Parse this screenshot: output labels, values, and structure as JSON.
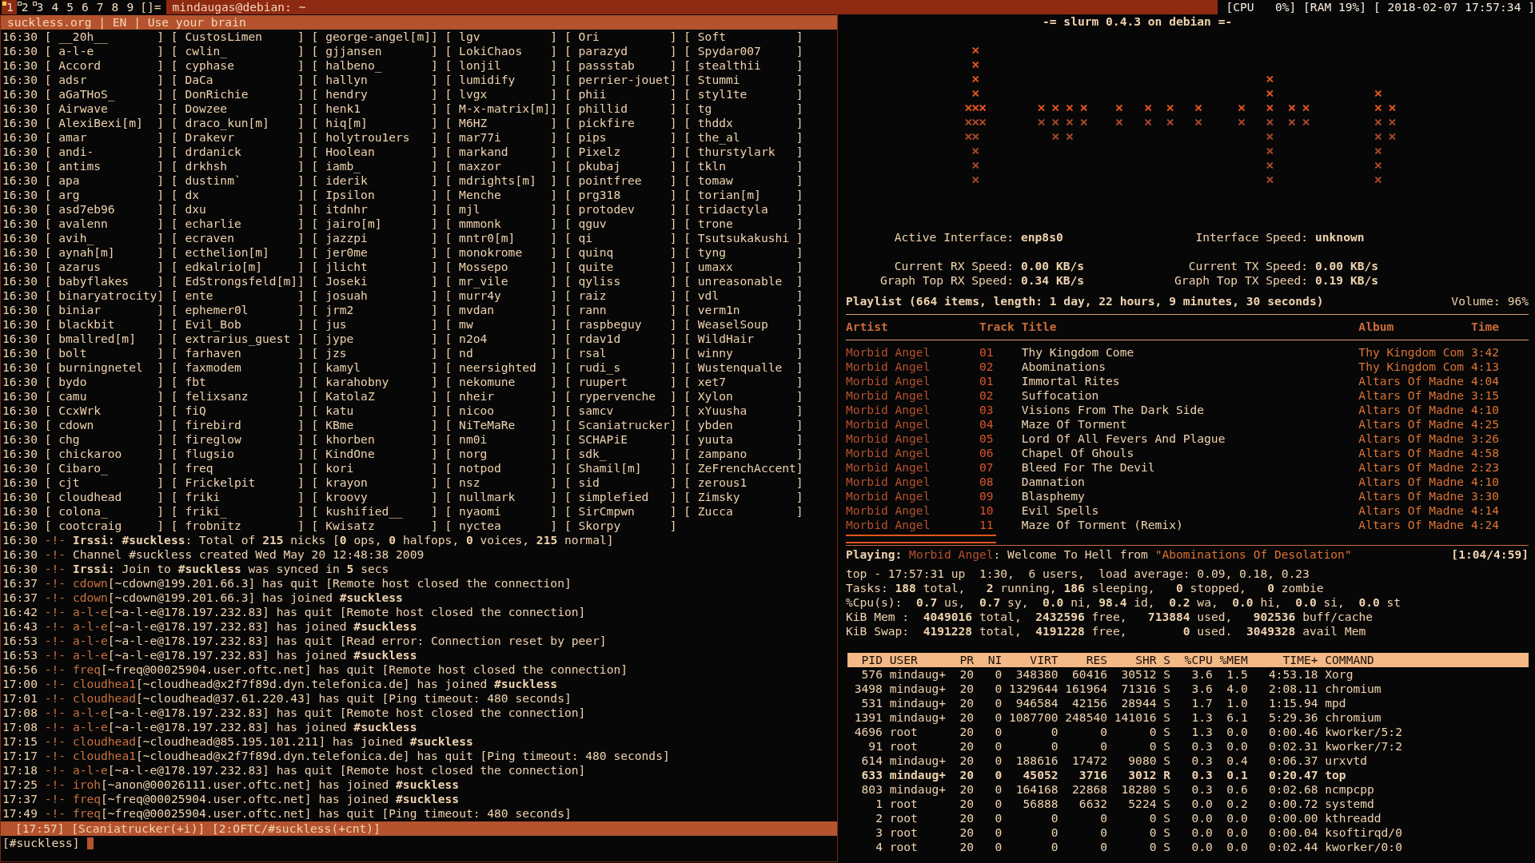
{
  "top_bar": {
    "tags": [
      {
        "label": "1",
        "selected": true,
        "occupied": true
      },
      {
        "label": "2",
        "selected": false,
        "occupied": true
      },
      {
        "label": "3",
        "selected": false,
        "occupied": true
      },
      {
        "label": "4",
        "selected": false,
        "occupied": false
      },
      {
        "label": "5",
        "selected": false,
        "occupied": false
      },
      {
        "label": "6",
        "selected": false,
        "occupied": false
      },
      {
        "label": "7",
        "selected": false,
        "occupied": false
      },
      {
        "label": "8",
        "selected": false,
        "occupied": false
      },
      {
        "label": "9",
        "selected": false,
        "occupied": false
      }
    ],
    "layout": "[]=",
    "title": "mindaugas@debian: ~",
    "status": "[CPU   0%] [RAM 19%] [ 2018-02-07 17:57:34 ]"
  },
  "irc": {
    "topic": "suckless.org | EN | Use your brain",
    "nick_lines": [
      "16:30 [ __20h__       ] [ CustosLimen     ] [ george-angel[m]] [ lgv          ] [ Ori          ] [ Soft          ]",
      "16:30 [ a-l-e         ] [ cwlin_          ] [ gjjansen       ] [ LokiChaos    ] [ parazyd      ] [ Spydar007     ]",
      "16:30 [ Accord        ] [ cyphase         ] [ halbeno_       ] [ lonjil       ] [ passstab     ] [ stealthii     ]",
      "16:30 [ adsr          ] [ DaCa            ] [ hallyn         ] [ lumidify     ] [ perrier-jouet] [ Stummi        ]",
      "16:30 [ aGaTHoS_      ] [ DonRichie       ] [ hendry         ] [ lvgx         ] [ phii         ] [ styl1te       ]",
      "16:30 [ Airwave       ] [ Dowzee          ] [ henk1          ] [ M-x-matrix[m]] [ phillid      ] [ tg            ]",
      "16:30 [ AlexiBexi[m]  ] [ draco_kun[m]    ] [ hiq[m]         ] [ M6HZ         ] [ pickfire     ] [ thddx         ]",
      "16:30 [ amar          ] [ Drakevr         ] [ holytrou1ers   ] [ mar77i       ] [ pips         ] [ the_al        ]",
      "16:30 [ andi-         ] [ drdanick        ] [ Hoolean        ] [ markand      ] [ Pixelz       ] [ thurstylark   ]",
      "16:30 [ antims        ] [ drkhsh          ] [ iamb_          ] [ maxzor       ] [ pkubaj       ] [ tkln          ]",
      "16:30 [ apa           ] [ dustinm`        ] [ iderik         ] [ mdrights[m]  ] [ pointfree    ] [ tomaw         ]",
      "16:30 [ arg           ] [ dx              ] [ Ipsilon        ] [ Menche       ] [ prg318       ] [ torian[m]     ]",
      "16:30 [ asd7eb96      ] [ dxu             ] [ itdnhr         ] [ mjl          ] [ protodev     ] [ tridactyla    ]",
      "16:30 [ avalenn       ] [ echarlie        ] [ jairo[m]       ] [ mmmonk       ] [ qguv         ] [ trone         ]",
      "16:30 [ avih_         ] [ ecraven         ] [ jazzpi         ] [ mntr0[m]     ] [ qi           ] [ Tsutsukakushi ]",
      "16:30 [ aynah[m]      ] [ ecthelion[m]    ] [ jer0me         ] [ monokrome    ] [ quinq        ] [ tyng          ]",
      "16:30 [ azarus        ] [ edkalrio[m]     ] [ jlicht         ] [ Mossepo      ] [ quite        ] [ umaxx         ]",
      "16:30 [ babyflakes    ] [ EdStrongsfeld[m]] [ Joseki         ] [ mr_vile      ] [ qyliss       ] [ unreasonable  ]",
      "16:30 [ binaryatrocity] [ ente            ] [ josuah         ] [ murr4y       ] [ raiz         ] [ vdl           ]",
      "16:30 [ biniar        ] [ ephemer0l       ] [ jrm2           ] [ mvdan        ] [ rann         ] [ verm1n        ]",
      "16:30 [ blackbit      ] [ Evil_Bob        ] [ jus            ] [ mw           ] [ raspbeguy    ] [ WeaselSoup    ]",
      "16:30 [ bmallred[m]   ] [ extrarius_guest ] [ jype           ] [ n2o4         ] [ rdav1d       ] [ WildHair      ]",
      "16:30 [ bolt          ] [ farhaven        ] [ jzs            ] [ nd           ] [ rsal         ] [ winny         ]",
      "16:30 [ burningnetel  ] [ faxmodem        ] [ kamyl          ] [ neersighted  ] [ rudi_s       ] [ Wustenqualle  ]",
      "16:30 [ bydo          ] [ fbt             ] [ karahobny      ] [ nekomune     ] [ ruupert      ] [ xet7          ]",
      "16:30 [ camu          ] [ felixsanz       ] [ KatolaZ        ] [ nheir        ] [ rypervenche  ] [ Xylon         ]",
      "16:30 [ CcxWrk        ] [ fiQ             ] [ katu           ] [ nicoo        ] [ samcv        ] [ xYuusha       ]",
      "16:30 [ cdown         ] [ firebird        ] [ KBme           ] [ NiTeMaRe     ] [ Scaniatrucker] [ ybden         ]",
      "16:30 [ chg           ] [ fireglow        ] [ khorben        ] [ nm0i         ] [ SCHAPiE      ] [ yuuta         ]",
      "16:30 [ chickaroo     ] [ flugsio         ] [ KindOne        ] [ norg         ] [ sdk_         ] [ zampano       ]",
      "16:30 [ Cibaro_       ] [ freq            ] [ kori           ] [ notpod       ] [ Shamil[m]    ] [ ZeFrenchAccent]",
      "16:30 [ cjt           ] [ Frickelpit      ] [ krayon         ] [ nsz          ] [ sid          ] [ zerous1       ]",
      "16:30 [ cloudhead     ] [ friki           ] [ kroovy         ] [ nullmark     ] [ simplefied   ] [ Zimsky        ]",
      "16:30 [ colona_       ] [ friki_          ] [ kushified__    ] [ nyaomi       ] [ SirCmpwn     ] [ Zucca         ]",
      "16:30 [ cootcraig     ] [ frobnitz        ] [ Kwisatz        ] [ nyctea       ] [ Skorpy       ]"
    ],
    "log": [
      {
        "time": "16:30",
        "marker": "-!-",
        "text": "**Irssi:** **#suckless**: Total of **215** nicks [**0** ops, **0** halfops, **0** voices, **215** normal]"
      },
      {
        "time": "16:30",
        "marker": "-!-",
        "text": "Channel #suckless created Wed May 20 12:48:38 2009"
      },
      {
        "time": "16:30",
        "marker": "-!-",
        "text": "**Irssi:** Join to **#suckless** was synced in **5** secs"
      },
      {
        "time": "16:37",
        "marker": "-!-",
        "nick": "cdown",
        "text": "[~cdown@199.201.66.3] has quit [Remote host closed the connection]"
      },
      {
        "time": "16:37",
        "marker": "-!-",
        "nick": "cdown",
        "text": "[~cdown@199.201.66.3] has joined **#suckless**"
      },
      {
        "time": "16:42",
        "marker": "-!-",
        "nick": "a-l-e",
        "text": "[~a-l-e@178.197.232.83] has quit [Remote host closed the connection]"
      },
      {
        "time": "16:43",
        "marker": "-!-",
        "nick": "a-l-e",
        "text": "[~a-l-e@178.197.232.83] has joined **#suckless**"
      },
      {
        "time": "16:53",
        "marker": "-!-",
        "nick": "a-l-e",
        "text": "[~a-l-e@178.197.232.83] has quit [Read error: Connection reset by peer]"
      },
      {
        "time": "16:53",
        "marker": "-!-",
        "nick": "a-l-e",
        "text": "[~a-l-e@178.197.232.83] has joined **#suckless**"
      },
      {
        "time": "16:56",
        "marker": "-!-",
        "nick": "freq",
        "text": "[~freq@00025904.user.oftc.net] has quit [Remote host closed the connection]"
      },
      {
        "time": "17:00",
        "marker": "-!-",
        "nick": "cloudhea1",
        "text": "[~cloudhead@x2f7f89d.dyn.telefonica.de] has joined **#suckless**"
      },
      {
        "time": "17:01",
        "marker": "-!-",
        "nick": "cloudhead",
        "text": "[~cloudhead@37.61.220.43] has quit [Ping timeout: 480 seconds]"
      },
      {
        "time": "17:08",
        "marker": "-!-",
        "nick": "a-l-e",
        "text": "[~a-l-e@178.197.232.83] has quit [Remote host closed the connection]"
      },
      {
        "time": "17:08",
        "marker": "-!-",
        "nick": "a-l-e",
        "text": "[~a-l-e@178.197.232.83] has joined **#suckless**"
      },
      {
        "time": "17:15",
        "marker": "-!-",
        "nick": "cloudhead",
        "text": "[~cloudhead@85.195.101.211] has joined **#suckless**"
      },
      {
        "time": "17:17",
        "marker": "-!-",
        "nick": "cloudhea1",
        "text": "[~cloudhead@x2f7f89d.dyn.telefonica.de] has quit [Ping timeout: 480 seconds]"
      },
      {
        "time": "17:18",
        "marker": "-!-",
        "nick": "a-l-e",
        "text": "[~a-l-e@178.197.232.83] has quit [Remote host closed the connection]"
      },
      {
        "time": "17:25",
        "marker": "-!-",
        "nick": "iroh",
        "text": "[~anon@00026111.user.oftc.net] has joined **#suckless**"
      },
      {
        "time": "17:37",
        "marker": "-!-",
        "nick": "freq",
        "text": "[~freq@00025904.user.oftc.net] has joined **#suckless**"
      },
      {
        "time": "17:49",
        "marker": "-!-",
        "nick": "freq",
        "text": "[~freq@00025904.user.oftc.net] has quit [Ping timeout: 480 seconds]"
      }
    ],
    "status_bar": "[17:57] [Scaniatrucker(+i)] [2:OFTC/#suckless(+cnt)]",
    "input_prompt": "[#suckless]"
  },
  "slurm": {
    "title": "-= slurm 0.4.3 on debian =-",
    "stat_rows": [
      [
        {
          "label": "Active Interface:",
          "value": "enp8s0"
        },
        {
          "label": "Interface Speed:",
          "value": "unknown"
        }
      ],
      [
        {
          "label": "Current RX Speed:",
          "value": "0.00 KB/s"
        },
        {
          "label": "Current TX Speed:",
          "value": "0.00 KB/s"
        }
      ],
      [
        {
          "label": "Graph Top RX Speed:",
          "value": "0.34 KB/s"
        },
        {
          "label": "Graph Top TX Speed:",
          "value": "0.19 KB/s"
        }
      ]
    ]
  },
  "player": {
    "summary": "Playlist (664 items, length: 1 day, 22 hours, 9 minutes, 30 seconds)",
    "volume": "Volume: 96%",
    "columns": [
      "Artist",
      "Track",
      "Title",
      "Album",
      "Time"
    ],
    "tracks": [
      {
        "artist": "Morbid Angel",
        "track": "01",
        "title": "Thy Kingdom Come",
        "album": "Thy Kingdom Com",
        "time": "3:42"
      },
      {
        "artist": "Morbid Angel",
        "track": "02",
        "title": "Abominations",
        "album": "Thy Kingdom Com",
        "time": "4:13"
      },
      {
        "artist": "Morbid Angel",
        "track": "01",
        "title": "Immortal Rites",
        "album": "Altars Of Madne",
        "time": "4:04"
      },
      {
        "artist": "Morbid Angel",
        "track": "02",
        "title": "Suffocation",
        "album": "Altars Of Madne",
        "time": "3:15"
      },
      {
        "artist": "Morbid Angel",
        "track": "03",
        "title": "Visions From The Dark Side",
        "album": "Altars Of Madne",
        "time": "4:10"
      },
      {
        "artist": "Morbid Angel",
        "track": "04",
        "title": "Maze Of Torment",
        "album": "Altars Of Madne",
        "time": "4:25"
      },
      {
        "artist": "Morbid Angel",
        "track": "05",
        "title": "Lord Of All Fevers And Plague",
        "album": "Altars Of Madne",
        "time": "3:26"
      },
      {
        "artist": "Morbid Angel",
        "track": "06",
        "title": "Chapel Of Ghouls",
        "album": "Altars Of Madne",
        "time": "4:58"
      },
      {
        "artist": "Morbid Angel",
        "track": "07",
        "title": "Bleed For The Devil",
        "album": "Altars Of Madne",
        "time": "2:23"
      },
      {
        "artist": "Morbid Angel",
        "track": "08",
        "title": "Damnation",
        "album": "Altars Of Madne",
        "time": "4:10"
      },
      {
        "artist": "Morbid Angel",
        "track": "09",
        "title": "Blasphemy",
        "album": "Altars Of Madne",
        "time": "3:30"
      },
      {
        "artist": "Morbid Angel",
        "track": "10",
        "title": "Evil Spells",
        "album": "Altars Of Madne",
        "time": "4:14"
      },
      {
        "artist": "Morbid Angel",
        "track": "11",
        "title": "Maze Of Torment (Remix)",
        "album": "Altars Of Madne",
        "time": "4:24"
      }
    ],
    "progress": {
      "level": 0.22
    },
    "playing": {
      "label": "Playing:",
      "artist": "Morbid Angel",
      "title": ": Welcome To Hell",
      "connector": "from",
      "album": "\"Abominations Of Desolation\"",
      "elapsed": "[1:04/4:59]"
    }
  },
  "top": {
    "summary": [
      "top - 17:57:31 up  1:30,  6 users,  load average: 0.09, 0.18, 0.23",
      "Tasks: **188** total,   **2** running, **186** sleeping,   **0** stopped,   **0** zombie",
      "%Cpu(s):  **0.7** us,  **0.7** sy,  **0.0** ni, **98.4** id,  **0.2** wa,  **0.0** hi,  **0.0** si,  **0.0** st",
      "KiB Mem :  **4049016** total,  **2432596** free,   **713884** used,   **902536** buff/cache",
      "KiB Swap:  **4191228** total,  **4191228** free,        **0** used.  **3049328** avail Mem"
    ],
    "columns": [
      "PID",
      "USER",
      "PR",
      "NI",
      "VIRT",
      "RES",
      "SHR",
      "S",
      "%CPU",
      "%MEM",
      "TIME+",
      "COMMAND"
    ],
    "processes": [
      {
        "cells": [
          "576",
          "mindaug+",
          "20",
          "0",
          "348380",
          "60416",
          "30512",
          "S",
          "3.6",
          "1.5",
          "4:53.18",
          "Xorg"
        ],
        "highlighted": false
      },
      {
        "cells": [
          "3498",
          "mindaug+",
          "20",
          "0",
          "1329644",
          "161964",
          "71316",
          "S",
          "3.6",
          "4.0",
          "2:08.11",
          "chromium"
        ],
        "highlighted": false
      },
      {
        "cells": [
          "531",
          "mindaug+",
          "20",
          "0",
          "946584",
          "42156",
          "28944",
          "S",
          "1.7",
          "1.0",
          "1:15.94",
          "mpd"
        ],
        "highlighted": false
      },
      {
        "cells": [
          "1391",
          "mindaug+",
          "20",
          "0",
          "1087700",
          "248540",
          "141016",
          "S",
          "1.3",
          "6.1",
          "5:29.36",
          "chromium"
        ],
        "highlighted": false
      },
      {
        "cells": [
          "4696",
          "root",
          "20",
          "0",
          "0",
          "0",
          "0",
          "S",
          "1.3",
          "0.0",
          "0:00.46",
          "kworker/5:2"
        ],
        "highlighted": false
      },
      {
        "cells": [
          "91",
          "root",
          "20",
          "0",
          "0",
          "0",
          "0",
          "S",
          "0.3",
          "0.0",
          "0:02.31",
          "kworker/7:2"
        ],
        "highlighted": false
      },
      {
        "cells": [
          "614",
          "mindaug+",
          "20",
          "0",
          "188616",
          "17472",
          "9080",
          "S",
          "0.3",
          "0.4",
          "0:06.37",
          "urxvtd"
        ],
        "highlighted": false
      },
      {
        "cells": [
          "633",
          "mindaug+",
          "20",
          "0",
          "45052",
          "3716",
          "3012",
          "R",
          "0.3",
          "0.1",
          "0:20.47",
          "top"
        ],
        "highlighted": true
      },
      {
        "cells": [
          "803",
          "mindaug+",
          "20",
          "0",
          "164168",
          "22868",
          "18280",
          "S",
          "0.3",
          "0.6",
          "0:02.68",
          "ncmpcpp"
        ],
        "highlighted": false
      },
      {
        "cells": [
          "1",
          "root",
          "20",
          "0",
          "56888",
          "6632",
          "5224",
          "S",
          "0.0",
          "0.2",
          "0:00.72",
          "systemd"
        ],
        "highlighted": false
      },
      {
        "cells": [
          "2",
          "root",
          "20",
          "0",
          "0",
          "0",
          "0",
          "S",
          "0.0",
          "0.0",
          "0:00.00",
          "kthreadd"
        ],
        "highlighted": false
      },
      {
        "cells": [
          "3",
          "root",
          "20",
          "0",
          "0",
          "0",
          "0",
          "S",
          "0.0",
          "0.0",
          "0:00.04",
          "ksoftirqd/0"
        ],
        "highlighted": false
      },
      {
        "cells": [
          "4",
          "root",
          "20",
          "0",
          "0",
          "0",
          "0",
          "S",
          "0.0",
          "0.0",
          "0:02.44",
          "kworker/0:0"
        ],
        "highlighted": false
      }
    ]
  }
}
